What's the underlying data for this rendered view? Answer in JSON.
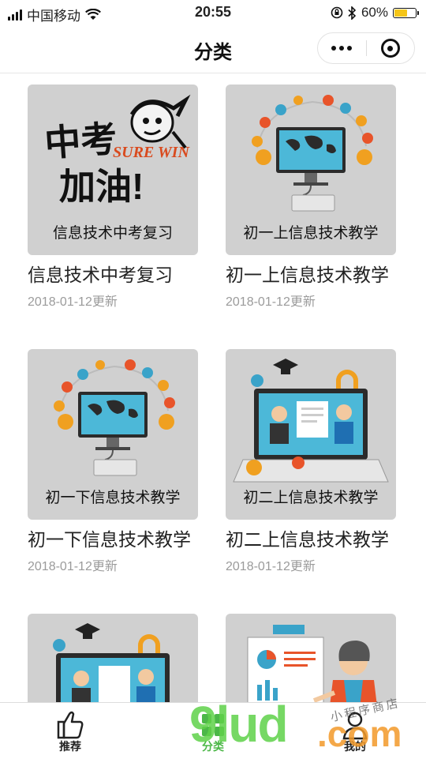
{
  "status_bar": {
    "carrier": "中国移动",
    "time": "20:55",
    "battery_percent": "60%",
    "battery_level": 0.6
  },
  "nav": {
    "title": "分类"
  },
  "cards": [
    {
      "caption": "信息技术中考复习",
      "title": "信息技术中考复习",
      "date": "2018-01-12更新",
      "thumb_text_1": "中考",
      "thumb_text_2": "SURE WIN",
      "thumb_text_3": "加油!"
    },
    {
      "caption": "初一上信息技术教学",
      "title": "初一上信息技术教学",
      "date": "2018-01-12更新"
    },
    {
      "caption": "初一下信息技术教学",
      "title": "初一下信息技术教学",
      "date": "2018-01-12更新"
    },
    {
      "caption": "初二上信息技术教学",
      "title": "初二上信息技术教学",
      "date": "2018-01-12更新"
    }
  ],
  "tabs": [
    {
      "label": "推荐",
      "icon": "thumbs-up-icon"
    },
    {
      "label": "分类",
      "icon": "grid-icon"
    },
    {
      "label": "我的",
      "icon": "user-icon"
    }
  ],
  "watermark": {
    "brand": "9lud",
    "domain": ".com",
    "tagline": "小程序商店"
  },
  "colors": {
    "accent": "#4cb748",
    "thumb_bg": "#d0d0d0",
    "date_gray": "#9b9b9b",
    "battery": "#f5c518"
  }
}
